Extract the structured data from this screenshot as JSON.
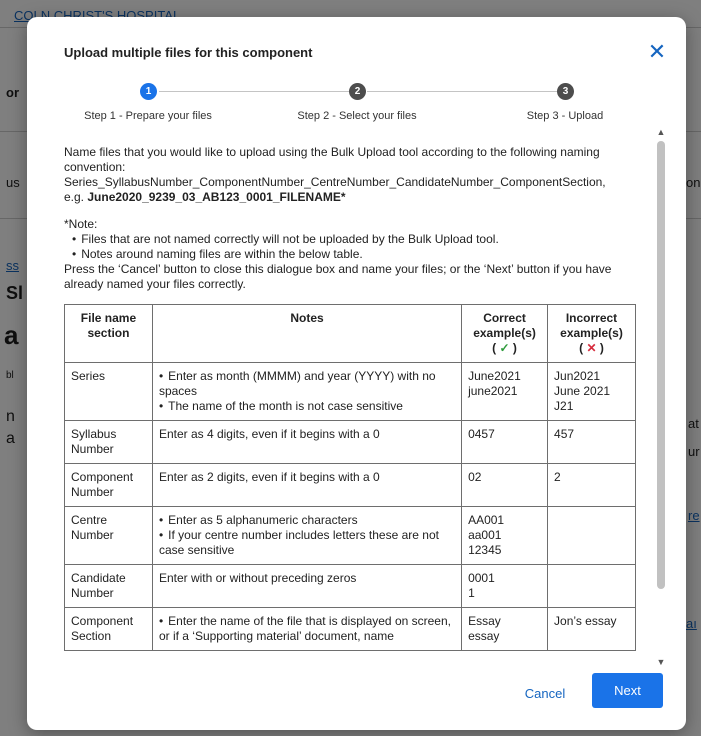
{
  "background": {
    "header_link": "COLN CHRIST'S HOSPITAL",
    "fragments": [
      "or",
      "us",
      "on",
      "ss",
      "Sl",
      "a",
      "bl",
      "n",
      "a",
      "at",
      "ur",
      "re",
      "aı"
    ]
  },
  "modal": {
    "title": "Upload multiple files for this component",
    "close_label": "✕",
    "steps": [
      {
        "number": "1",
        "label": "Step 1 - Prepare your files"
      },
      {
        "number": "2",
        "label": "Step 2 - Select your files"
      },
      {
        "number": "3",
        "label": "Step 3 - Upload"
      }
    ],
    "intro": "Name files that you would like to upload using the Bulk Upload tool according to the following naming convention:",
    "convention": "Series_SyllabusNumber_ComponentNumber_CentreNumber_CandidateNumber_ComponentSection,",
    "example_prefix": "e.g. ",
    "example": "June2020_9239_03_AB123_0001_FILENAME*",
    "note_heading": "*Note:",
    "notes": [
      "Files that are not named correctly will not be uploaded by the Bulk Upload tool.",
      "Notes around naming files are within the below table."
    ],
    "instructions": "Press the ‘Cancel’ button to close this dialogue box and name your files; or the ‘Next’ button if you have already named your files correctly.",
    "table": {
      "headers": {
        "section": "File name section",
        "notes": "Notes",
        "correct": "Correct example(s)",
        "correct_mark": "✓",
        "incorrect": "Incorrect example(s)",
        "incorrect_mark": "✕"
      },
      "rows": [
        {
          "section": "Series",
          "notes": [
            "Enter as month (MMMM) and year (YYYY) with no spaces",
            "The name of the month is not case sensitive"
          ],
          "correct": [
            "June2021",
            "june2021"
          ],
          "incorrect": [
            "Jun2021",
            "June 2021",
            "J21"
          ]
        },
        {
          "section": "Syllabus Number",
          "note": "Enter as 4 digits, even if it begins with a 0",
          "correct": [
            "0457"
          ],
          "incorrect": [
            "457"
          ]
        },
        {
          "section": "Component Number",
          "note": "Enter as 2 digits, even if it begins with a 0",
          "correct": [
            "02"
          ],
          "incorrect": [
            "2"
          ]
        },
        {
          "section": "Centre Number",
          "notes": [
            "Enter as 5 alphanumeric characters",
            "If your centre number includes letters these are not case sensitive"
          ],
          "correct": [
            "AA001",
            "aa001",
            "12345"
          ],
          "incorrect": []
        },
        {
          "section": "Candidate Number",
          "note": "Enter with or without preceding zeros",
          "correct": [
            "0001",
            "1"
          ],
          "incorrect": []
        },
        {
          "section": "Component Section",
          "notes": [
            "Enter the name of the file that is displayed on screen, or if a ‘Supporting material’ document, name"
          ],
          "correct": [
            "Essay",
            "essay"
          ],
          "incorrect": [
            "Jon’s essay"
          ]
        }
      ]
    },
    "cancel_label": "Cancel",
    "next_label": "Next"
  },
  "colors": {
    "accent": "#1a73e8",
    "link": "#1565c0",
    "correct_mark": "#2e9b3b",
    "incorrect_mark": "#d62b3c"
  }
}
